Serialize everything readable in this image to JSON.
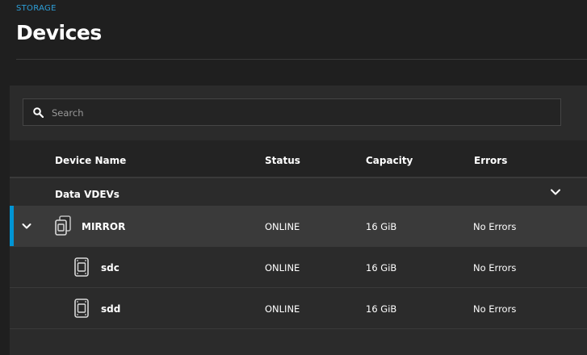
{
  "breadcrumb": "STORAGE",
  "page_title": "Devices",
  "search": {
    "placeholder": "Search"
  },
  "columns": {
    "name": "Device Name",
    "status": "Status",
    "capacity": "Capacity",
    "errors": "Errors"
  },
  "group": {
    "label": "Data VDEVs",
    "collapse_icon": "chevron-up-icon"
  },
  "rows": [
    {
      "name": "MIRROR",
      "status": "ONLINE",
      "capacity": "16 GiB",
      "errors": "No Errors",
      "icon": "mirror-icon",
      "selected": true
    },
    {
      "name": "sdc",
      "status": "ONLINE",
      "capacity": "16 GiB",
      "errors": "No Errors",
      "icon": "disk-icon"
    },
    {
      "name": "sdd",
      "status": "ONLINE",
      "capacity": "16 GiB",
      "errors": "No Errors",
      "icon": "disk-icon"
    }
  ],
  "colors": {
    "accent": "#0095d5",
    "breadcrumb": "#2d9fd8"
  }
}
